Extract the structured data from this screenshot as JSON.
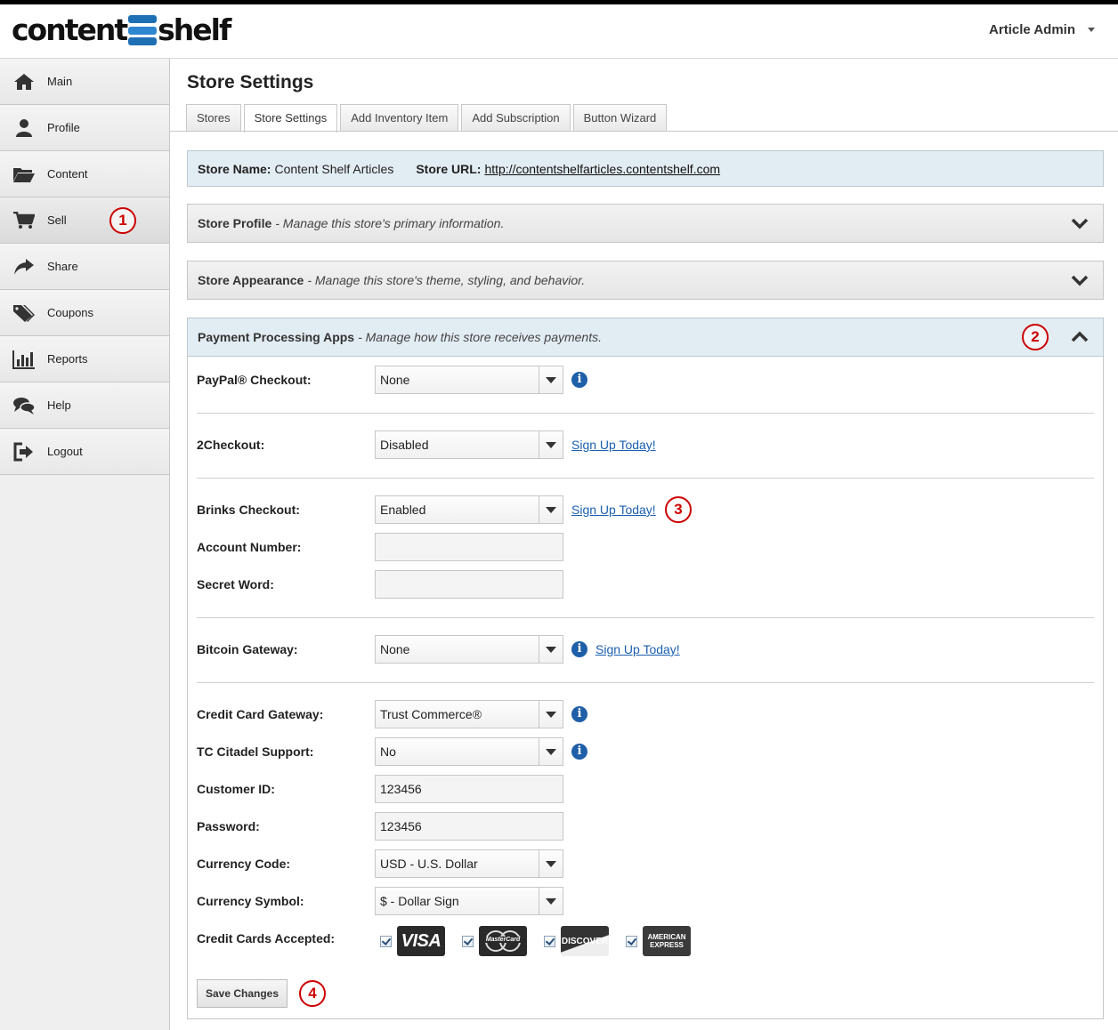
{
  "app": {
    "logo_left": "content",
    "logo_right": "shelf",
    "user_menu_label": "Article Admin"
  },
  "sidebar": {
    "items": [
      {
        "label": "Main",
        "icon": "home-icon"
      },
      {
        "label": "Profile",
        "icon": "user-icon"
      },
      {
        "label": "Content",
        "icon": "folder-icon"
      },
      {
        "label": "Sell",
        "icon": "cart-icon"
      },
      {
        "label": "Share",
        "icon": "share-icon"
      },
      {
        "label": "Coupons",
        "icon": "tags-icon"
      },
      {
        "label": "Reports",
        "icon": "bar-chart-icon"
      },
      {
        "label": "Help",
        "icon": "chat-icon"
      },
      {
        "label": "Logout",
        "icon": "logout-icon"
      }
    ],
    "active": "Sell"
  },
  "page": {
    "title": "Store Settings",
    "tabs": [
      "Stores",
      "Store Settings",
      "Add Inventory Item",
      "Add Subscription",
      "Button Wizard"
    ],
    "active_tab": "Store Settings"
  },
  "store_bar": {
    "name_label": "Store Name:",
    "name_value": "Content Shelf Articles",
    "url_label": "Store URL:",
    "url_value": "http://contentshelfarticles.contentshelf.com"
  },
  "panels": {
    "profile": {
      "title": "Store Profile",
      "desc": "- Manage this store's primary information."
    },
    "appearance": {
      "title": "Store Appearance",
      "desc": "- Manage this store's theme, styling, and behavior."
    },
    "payment": {
      "title": "Payment Processing Apps",
      "desc": "- Manage how this store receives payments."
    }
  },
  "form": {
    "paypal": {
      "label": "PayPal® Checkout:",
      "value": "None"
    },
    "twocheckout": {
      "label": "2Checkout:",
      "value": "Disabled",
      "link": "Sign Up Today!"
    },
    "brinks": {
      "label": "Brinks Checkout:",
      "value": "Enabled",
      "link": "Sign Up Today!"
    },
    "account_number": {
      "label": "Account Number:",
      "value": ""
    },
    "secret_word": {
      "label": "Secret Word:",
      "value": ""
    },
    "bitcoin": {
      "label": "Bitcoin Gateway:",
      "value": "None",
      "link": "Sign Up Today!"
    },
    "cc_gateway": {
      "label": "Credit Card Gateway:",
      "value": "Trust Commerce®"
    },
    "tc_citadel": {
      "label": "TC Citadel Support:",
      "value": "No"
    },
    "customer_id": {
      "label": "Customer ID:",
      "value": "123456"
    },
    "password": {
      "label": "Password:",
      "value": "123456"
    },
    "currency_code": {
      "label": "Currency Code:",
      "value": "USD - U.S. Dollar"
    },
    "currency_symbol": {
      "label": "Currency Symbol:",
      "value": "$ - Dollar Sign"
    },
    "cards_accepted": {
      "label": "Credit Cards Accepted:",
      "cards": [
        {
          "name": "VISA",
          "checked": true
        },
        {
          "name": "MasterCard",
          "checked": true
        },
        {
          "name": "DISCOVER",
          "checked": true
        },
        {
          "name": "AMERICAN EXPRESS",
          "checked": true
        }
      ]
    },
    "save_label": "Save Changes"
  },
  "annotations": [
    "1",
    "2",
    "3",
    "4"
  ],
  "colors": {
    "link": "#1b5fb0",
    "info_icon": "#1f5fa8",
    "annotation": "#cc0000",
    "store_bar_bg": "#e2ecf3",
    "logo_blue": "#1f6fb5"
  }
}
